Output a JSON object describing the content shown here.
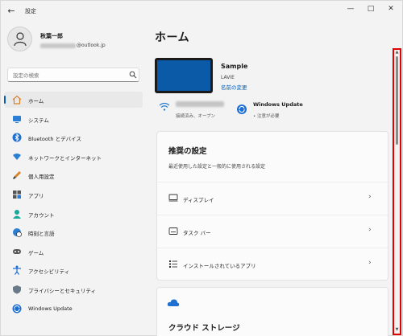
{
  "window": {
    "title": "設定",
    "back_icon": "back-arrow-icon",
    "controls": {
      "minimize": "—",
      "maximize": "□",
      "close": "✕"
    }
  },
  "profile": {
    "name": "秋葉一郎",
    "email_suffix": "@outlook.jp",
    "avatar_icon": "user-avatar-icon"
  },
  "search": {
    "placeholder": "設定の検索",
    "icon": "search-icon"
  },
  "sidebar": {
    "items": [
      {
        "label": "ホーム",
        "icon": "home-icon",
        "active": true
      },
      {
        "label": "システム",
        "icon": "monitor-icon"
      },
      {
        "label": "Bluetooth とデバイス",
        "icon": "bluetooth-icon"
      },
      {
        "label": "ネットワークとインターネット",
        "icon": "network-icon"
      },
      {
        "label": "個人用設定",
        "icon": "brush-icon"
      },
      {
        "label": "アプリ",
        "icon": "apps-icon"
      },
      {
        "label": "アカウント",
        "icon": "account-icon"
      },
      {
        "label": "時刻と言語",
        "icon": "globe-clock-icon"
      },
      {
        "label": "ゲーム",
        "icon": "gamepad-icon"
      },
      {
        "label": "アクセシビリティ",
        "icon": "accessibility-icon"
      },
      {
        "label": "プライバシーとセキュリティ",
        "icon": "shield-icon"
      },
      {
        "label": "Windows Update",
        "icon": "update-icon"
      }
    ]
  },
  "main": {
    "title": "ホーム",
    "device": {
      "name": "Sample",
      "model": "LAVIE",
      "rename_link": "名前の変更"
    },
    "wifi": {
      "status": "接続済み、オープン",
      "icon": "wifi-icon"
    },
    "windows_update": {
      "title": "Windows Update",
      "status": "• 注意が必要",
      "icon": "update-icon"
    },
    "recommended": {
      "title": "推奨の設定",
      "subtitle": "最近使用した設定と一般的に使用される設定",
      "rows": [
        {
          "label": "ディスプレイ",
          "icon": "display-icon"
        },
        {
          "label": "タスク バー",
          "icon": "taskbar-icon"
        },
        {
          "label": "インストールされているアプリ",
          "icon": "installed-apps-icon"
        }
      ]
    },
    "cloud": {
      "title": "クラウド ストレージ",
      "icon": "onedrive-cloud-icon"
    }
  },
  "colors": {
    "accent": "#005fb8",
    "device": "#0a5aa8",
    "highlight": "#e30000"
  }
}
